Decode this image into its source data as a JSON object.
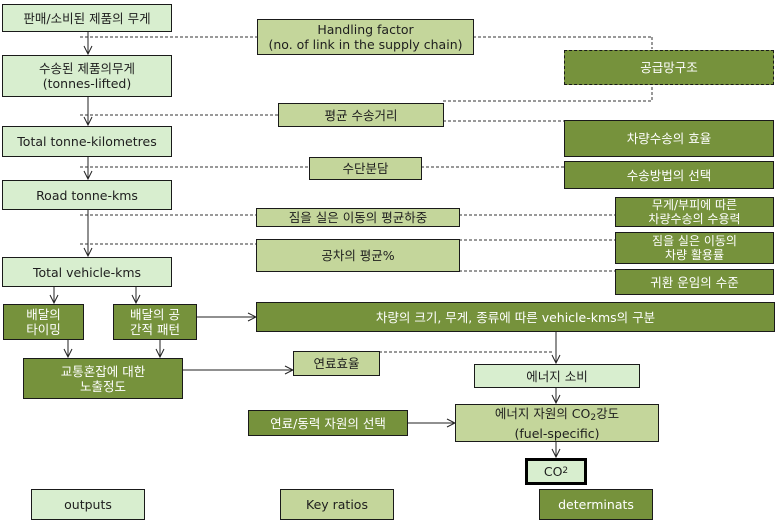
{
  "diagram": {
    "colors": {
      "outputs_fill": "#d8eecf",
      "key_ratios_fill": "#c4d69b",
      "determinants_fill": "#76923c",
      "border": "#1a1a1a"
    },
    "outputs": {
      "product_weight_sold": "판매/소비된 제품의 무게",
      "product_weight_transported": "수송된 제품의무게\n(tonnes-lifted)",
      "total_tonne_km": "Total tonne-kilometres",
      "road_tonne_km": "Road tonne-kms",
      "total_vehicle_km": "Total vehicle-kms",
      "energy_consumption": "에너지 소비",
      "co2_intensity_line1": "에너지 자원의 CO",
      "co2_intensity_sub": "2",
      "co2_intensity_line1_end": "강도",
      "co2_intensity_line2": "(fuel-specific)",
      "co2_main": "CO",
      "co2_sub": "2"
    },
    "key_ratios": {
      "handling_factor": "Handling factor\n(no. of link in the supply chain)",
      "avg_haul_length": "평균 수송거리",
      "modal_split": "수단분담",
      "avg_payload": "짐을 실은 이동의 평균하중",
      "avg_empty_running": "공차의 평균%",
      "fuel_efficiency": "연료효율"
    },
    "determinants": {
      "supply_chain_structure": "공급망구조",
      "vehicle_transport_efficiency": "차량수송의 효율",
      "transport_mode_choice": "수송방법의 선택",
      "vehicle_capacity": "무게/부피에 따른\n차량수송의 수용력",
      "vehicle_utilization": "짐을 실은 이동의\n차량 활용률",
      "backload_level": "귀환 운임의 수준",
      "delivery_timing": "배달의\n타이밍",
      "delivery_spatial_pattern": "배달의 공\n간적 패턴",
      "vehicle_km_split": "차량의 크기, 무게, 종류에 따른 vehicle-kms의 구분",
      "congestion_exposure": "교통혼잡에 대한\n노출정도",
      "fuel_source_choice": "연료/동력 자원의 선택"
    },
    "legend": {
      "outputs": "outputs",
      "key_ratios": "Key ratios",
      "determinants": "determinats"
    }
  }
}
